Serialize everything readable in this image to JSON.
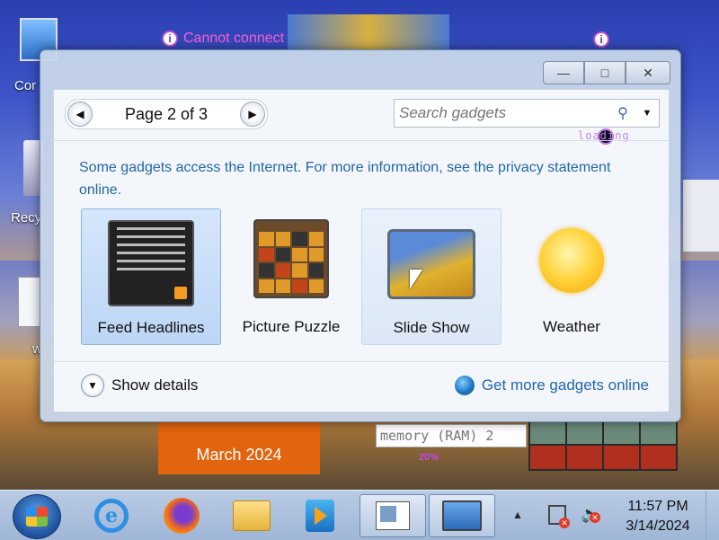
{
  "desktop": {
    "icons": [
      {
        "label": "Cor"
      },
      {
        "label": "Recy"
      },
      {
        "label": "w"
      }
    ],
    "cannot_connect": "Cannot connect",
    "calendar_month": "March 2024",
    "memory_text": "memory (RAM) 2",
    "memory_percent": "20%"
  },
  "window": {
    "controls": {
      "minimize": "—",
      "restore": "□",
      "close": "✕"
    },
    "pager": {
      "prev": "◀",
      "label": "Page 2 of 3",
      "next": "▶"
    },
    "search": {
      "placeholder": "Search gadgets",
      "loading": "loading"
    },
    "notice": "Some gadgets access the Internet.  For more information, see the privacy statement online.",
    "gadgets": [
      {
        "name": "Feed Headlines",
        "icon": "feed-icon"
      },
      {
        "name": "Picture Puzzle",
        "icon": "puzzle-icon"
      },
      {
        "name": "Slide Show",
        "icon": "slideshow-icon"
      },
      {
        "name": "Weather",
        "icon": "sun-icon"
      }
    ],
    "show_details": "Show details",
    "get_more": "Get more gadgets online"
  },
  "taskbar": {
    "clock_time": "11:57 PM",
    "clock_date": "3/14/2024",
    "ie_glyph": "e"
  }
}
